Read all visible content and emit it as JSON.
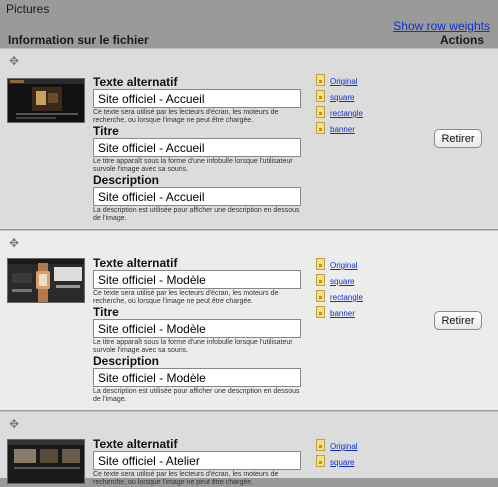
{
  "section_title": "Pictures",
  "show_row_weights": "Show row weights",
  "columns": {
    "info": "Information sur le fichier",
    "actions": "Actions"
  },
  "labels": {
    "alt": "Texte alternatif",
    "alt_help": "Ce texte sera utilisé par les lecteurs d'écran, les moteurs de recherche, ou lorsque l'image ne peut être chargée.",
    "title": "Titre",
    "title_help": "Le titre apparaît sous la forme d'une infobulle lorsque l'utilisateur survole l'image avec sa souris.",
    "description": "Description",
    "description_help": "La description est utilisée pour afficher une description en dessous de l'image."
  },
  "styles": [
    "Original",
    "square",
    "rectangle",
    "banner"
  ],
  "remove_label": "Retirer",
  "rows": [
    {
      "alt": "Site officiel - Accueil",
      "title": "Site officiel - Accueil",
      "description": "Site officiel - Accueil"
    },
    {
      "alt": "Site officiel - Modèle",
      "title": "Site officiel - Modèle",
      "description": "Site officiel - Modèle"
    },
    {
      "alt": "Site officiel - Atelier",
      "title": "",
      "description": ""
    }
  ]
}
